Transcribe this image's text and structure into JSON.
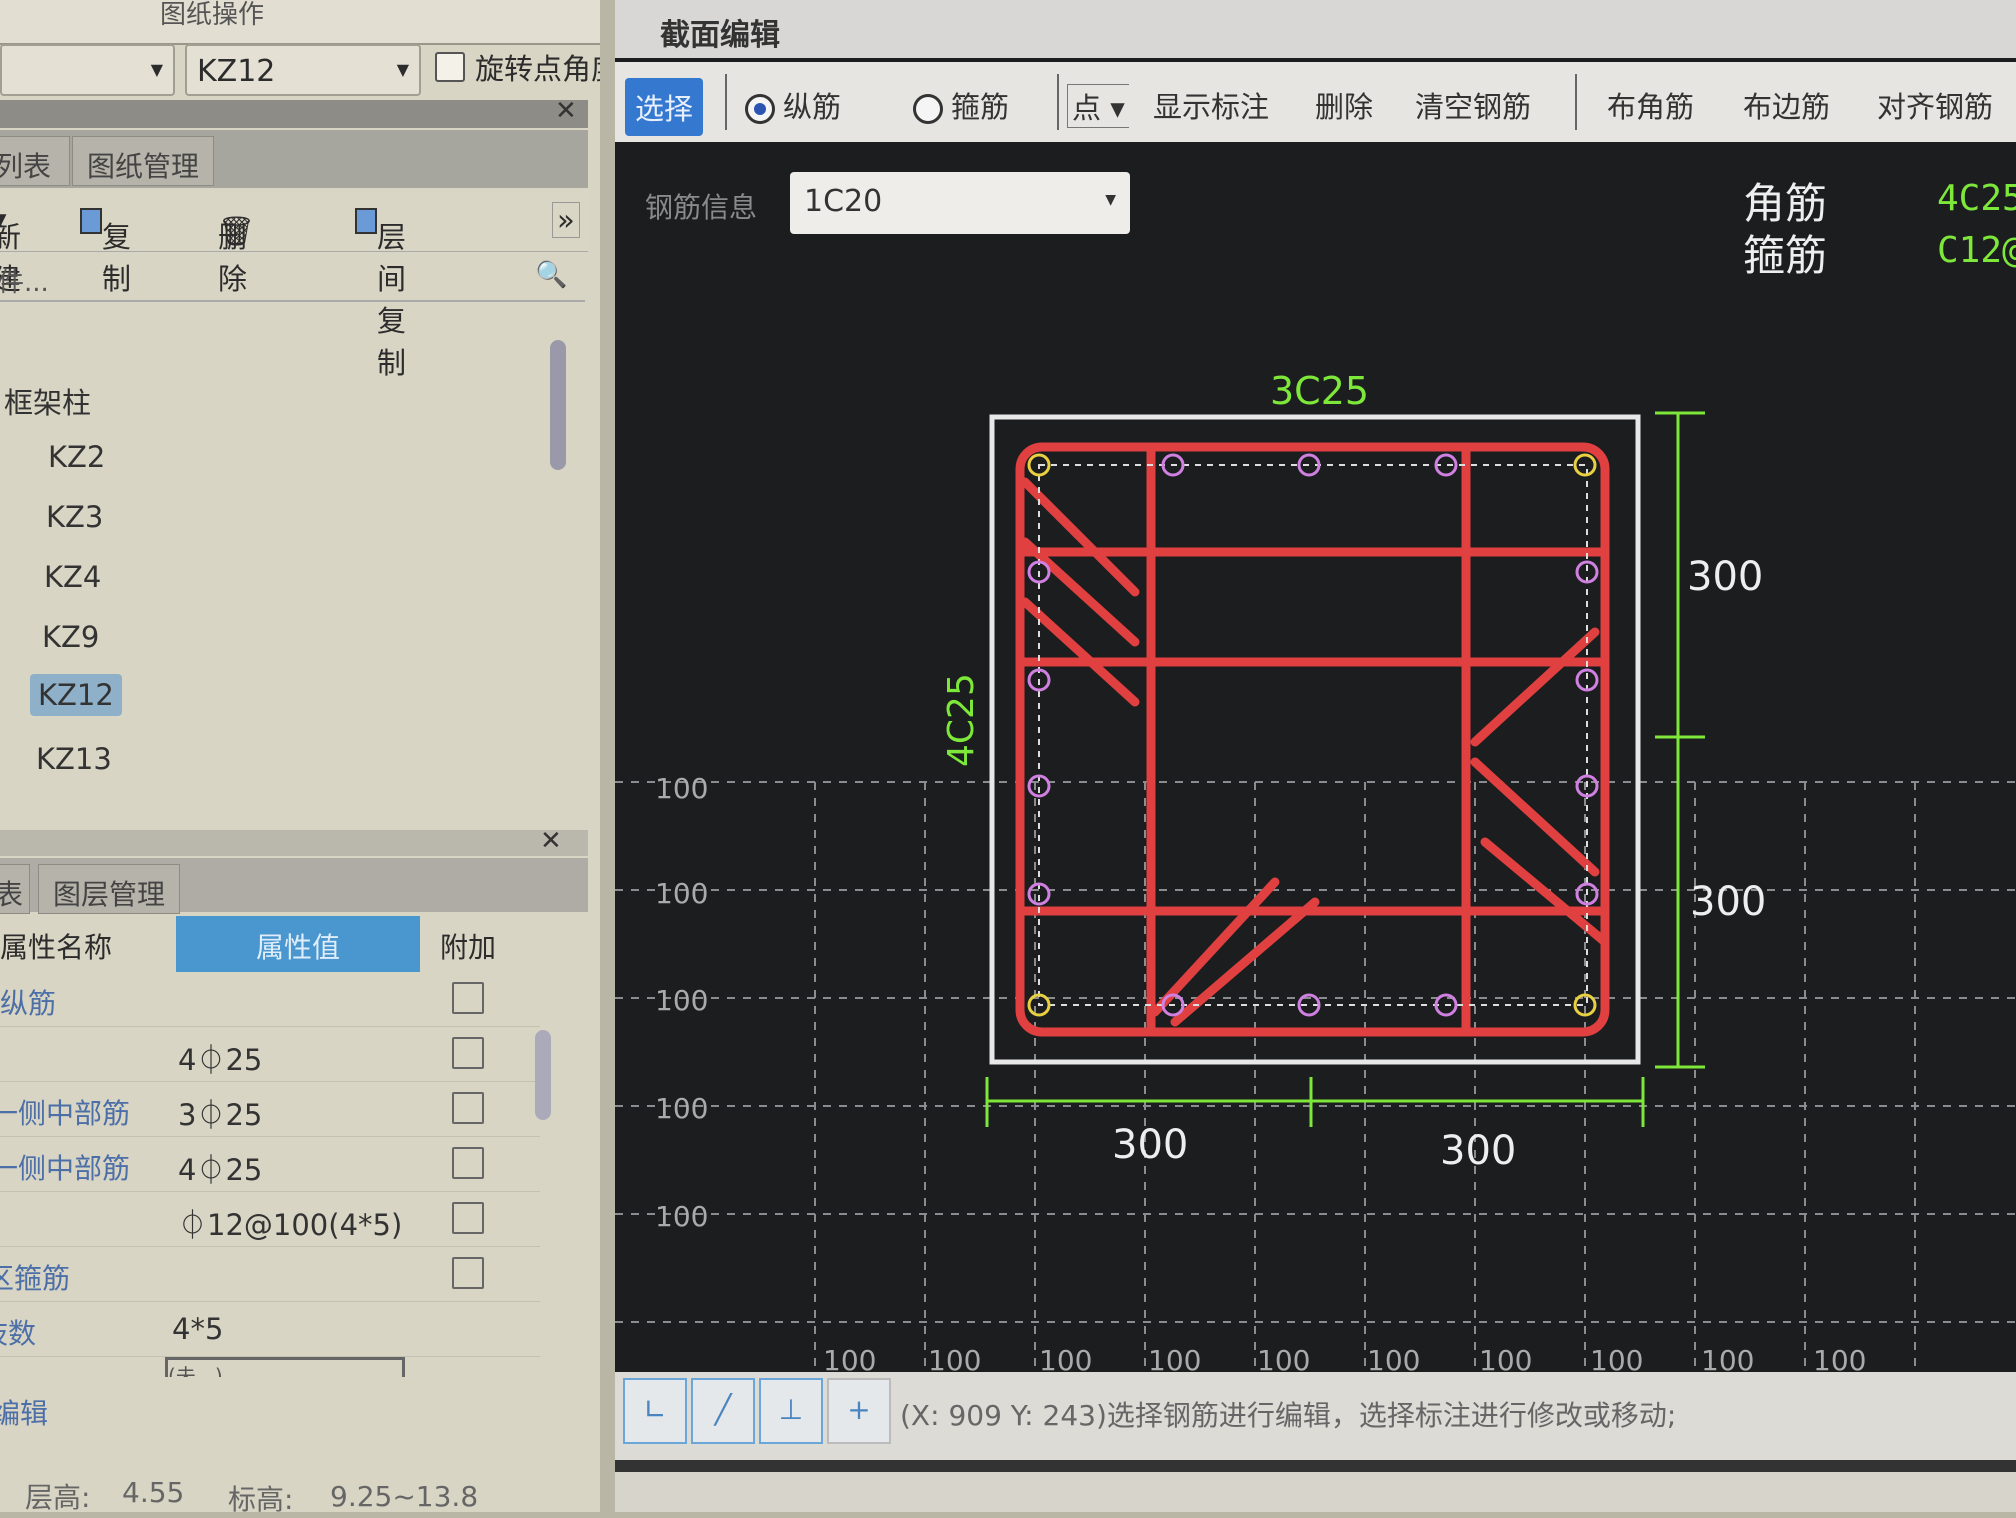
{
  "left_panel": {
    "top_label": "图纸操作",
    "floor_combo": "",
    "component_combo": "KZ12",
    "rotate_checkbox_label": "旋转点角度",
    "tabs": [
      "列表",
      "图纸管理"
    ],
    "toolbar": {
      "new": "新建",
      "copy": "复制",
      "delete": "删除",
      "floor_copy": "层间复制",
      "more": "»"
    },
    "search_placeholder": "搜索构件...",
    "tree": {
      "group": "框架柱",
      "items": [
        "KZ2",
        "KZ3",
        "KZ4",
        "KZ9",
        "KZ12",
        "KZ13"
      ],
      "selected": "KZ12"
    },
    "tabs2": [
      "表",
      "图层管理"
    ],
    "props": {
      "headers": [
        "属性名称",
        "属性值",
        "附加"
      ],
      "rows": [
        {
          "name": "纵筋",
          "value": ""
        },
        {
          "name": "",
          "value": "4⏀25"
        },
        {
          "name": "一侧中部筋",
          "value": "3⏀25"
        },
        {
          "name": "一侧中部筋",
          "value": "4⏀25"
        },
        {
          "name": "",
          "value": "⏀12@100(4*5)"
        },
        {
          "name": "区箍筋",
          "value": ""
        },
        {
          "name": "肢数",
          "value": "4*5"
        }
      ],
      "dropdown_value": "(未...)",
      "edit_label": "编辑"
    },
    "status": {
      "floor_height_label": "层高:",
      "floor_height": "4.55",
      "elevation_label": "标高:",
      "elevation": "9.25~13.8"
    }
  },
  "dialog": {
    "title": "截面编辑",
    "toolbar": {
      "select": "选择",
      "longitudinal": "纵筋",
      "stirrup": "箍筋",
      "point": "点",
      "show_label": "显示标注",
      "delete": "删除",
      "clear": "清空钢筋",
      "corner": "布角筋",
      "edge": "布边筋",
      "align": "对齐钢筋"
    },
    "selected_radio": "纵筋",
    "rebar_info_label": "钢筋信息",
    "rebar_info_value": "1C20",
    "legend": {
      "corner_label": "角筋",
      "corner_value": "4C25",
      "stirrup_label": "箍筋",
      "stirrup_value": "C12@"
    },
    "section": {
      "top_label": "3C25",
      "left_label": "4C25",
      "dims_right": [
        "300",
        "300"
      ],
      "dims_bottom": [
        "300",
        "300"
      ],
      "grid_label": "100"
    },
    "status_text": "(X: 909 Y: 243)选择钢筋进行编辑，选择标注进行修改或移动;",
    "colors": {
      "rebar": "#e04040",
      "dim": "#7ee83a",
      "grid": "#8a8c90",
      "select": "#3478d0"
    }
  }
}
